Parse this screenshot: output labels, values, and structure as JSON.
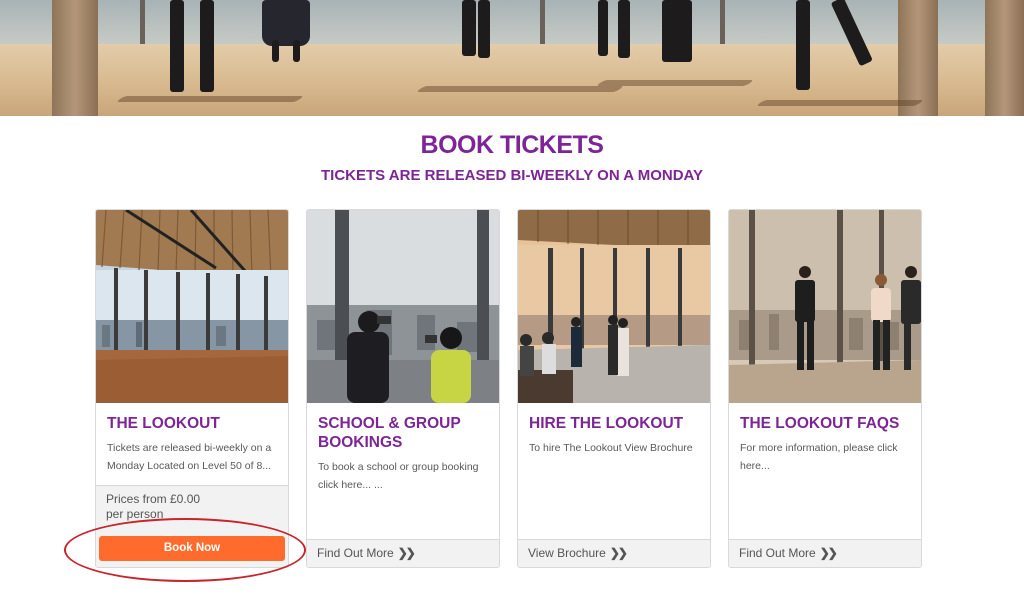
{
  "header": {
    "title": "BOOK TICKETS",
    "subtitle": "TICKETS ARE RELEASED BI-WEEKLY ON A MONDAY"
  },
  "cards": [
    {
      "title": "THE LOOKOUT",
      "text": "Tickets are released bi-weekly on a Monday Located on Level 50 of 8...",
      "price_line1": "Prices from £0.00",
      "price_line2": "per person",
      "button": "Book Now",
      "image": "empty-viewing-gallery-photo"
    },
    {
      "title": "SCHOOL & GROUP BOOKINGS",
      "text": "To book a school or group booking click here... ...",
      "link": "Find Out More",
      "image": "visitors-with-binoculars-photo"
    },
    {
      "title": "HIRE THE LOOKOUT",
      "text": "To hire The Lookout View Brochure",
      "link": "View Brochure",
      "image": "event-guests-gallery-photo"
    },
    {
      "title": "THE LOOKOUT FAQS",
      "text": "For more information, please click here...",
      "link": "Find Out More",
      "image": "people-at-window-photo"
    }
  ],
  "link_chevron": "❯❯",
  "colors": {
    "brand_purple": "#7d2596",
    "button_orange": "#ff6b2c",
    "highlight_red": "#c8242c",
    "footer_gray": "#f2f2f2"
  }
}
